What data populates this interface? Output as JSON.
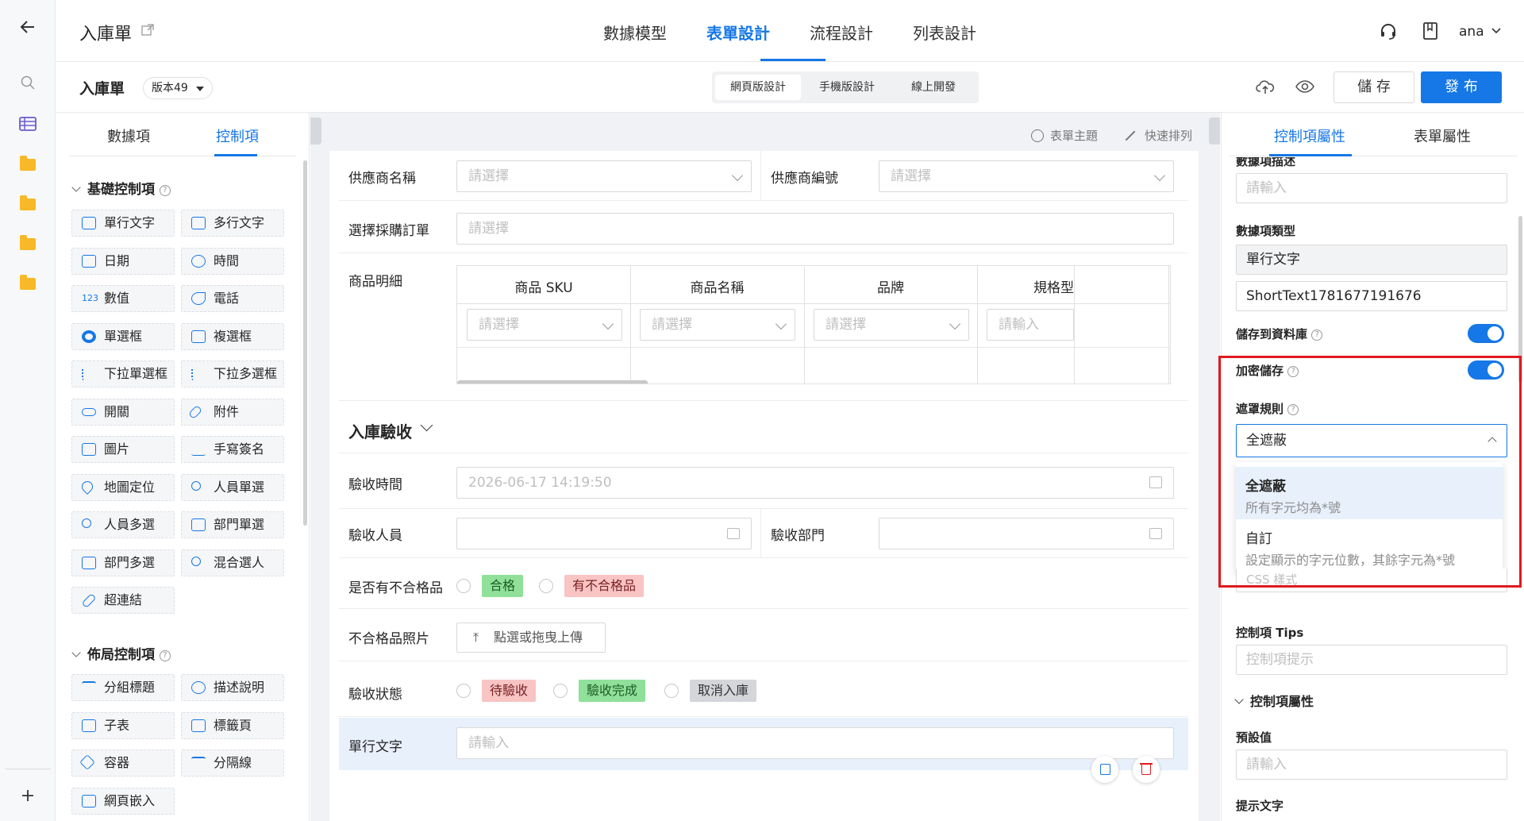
{
  "topbar": {
    "title": "入庫單",
    "tabs": [
      "數據模型",
      "表單設計",
      "流程設計",
      "列表設計"
    ],
    "active_tab": "表單設計",
    "user": "ana"
  },
  "subbar": {
    "title": "入庫單",
    "version": "版本49",
    "modes": [
      "網頁版設計",
      "手機版設計",
      "線上開發"
    ],
    "save": "儲 存",
    "publish": "發 布"
  },
  "left_panel": {
    "tabs": [
      "數據項",
      "控制項"
    ],
    "basic_title": "基礎控制項",
    "basic_items": [
      "單行文字",
      "多行文字",
      "日期",
      "時間",
      "數值",
      "電話",
      "單選框",
      "複選框",
      "下拉單選框",
      "下拉多選框",
      "開關",
      "附件",
      "圖片",
      "手寫簽名",
      "地圖定位",
      "人員單選",
      "人員多選",
      "部門單選",
      "部門多選",
      "混合選人",
      "超連結"
    ],
    "layout_title": "佈局控制項",
    "layout_items": [
      "分組標題",
      "描述說明",
      "子表",
      "標籤頁",
      "容器",
      "分隔線",
      "網頁嵌入"
    ]
  },
  "canvas": {
    "toolbar": [
      "表單主題",
      "快速排列"
    ],
    "supplier_name": "供應商名稱",
    "supplier_code": "供應商編號",
    "select_placeholder": "請選擇",
    "input_placeholder": "請輸入",
    "purchase_order": "選擇採購訂單",
    "items_label": "商品明細",
    "table_headers": [
      "商品 SKU",
      "商品名稱",
      "品牌",
      "規格型"
    ],
    "section": "入庫驗收",
    "inspect_time": "驗收時間",
    "inspect_time_value": "2026-06-17 14:19:50",
    "inspector": "驗收人員",
    "inspect_dept": "驗收部門",
    "has_defect": "是否有不合格品",
    "defect_options": [
      "合格",
      "有不合格品"
    ],
    "defect_photo": "不合格品照片",
    "upload": "點選或拖曳上傳",
    "status": "驗收狀態",
    "status_options": [
      "待驗收",
      "驗收完成",
      "取消入庫"
    ],
    "single_text": "單行文字"
  },
  "right_panel": {
    "tabs": [
      "控制項屬性",
      "表單屬性"
    ],
    "data_desc": "數據項描述",
    "data_type_label": "數據項類型",
    "data_type_value": "單行文字",
    "field_id": "ShortText1781677191676",
    "save_db": "儲存到資料庫",
    "encrypt": "加密儲存",
    "mask_rule": "遮罩規則",
    "mask_value": "全遮蔽",
    "options": [
      {
        "title": "全遮蔽",
        "desc": "所有字元均為*號"
      },
      {
        "title": "自訂",
        "desc": "設定顯示的字元位數，其餘字元為*號"
      }
    ],
    "css_placeholder": "CSS 樣式",
    "tips_label": "控制項 Tips",
    "tips_placeholder": "控制項提示",
    "props_section": "控制項屬性",
    "default_label": "預設值",
    "hint_label": "提示文字"
  }
}
